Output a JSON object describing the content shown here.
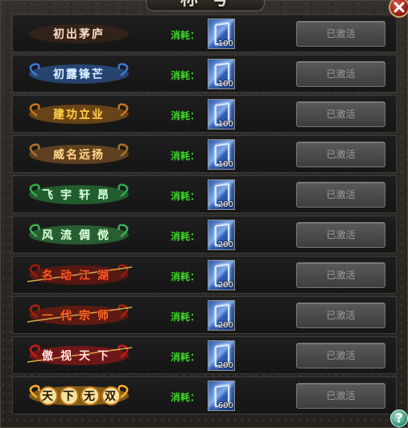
{
  "window": {
    "title": "称号",
    "help_label": "?"
  },
  "colors": {
    "cost_label": "#3fd82a",
    "button_text": "#9c9c9c"
  },
  "titles": [
    {
      "name": "初出茅庐",
      "cost_label": "消耗：",
      "item_icon": "scroll-icon",
      "item_count": "100",
      "button_label": "已激活",
      "badge_color": "#f0e0d0",
      "glow": "#7a3a1a"
    },
    {
      "name": "初露锋芒",
      "cost_label": "消耗：",
      "item_icon": "scroll-icon",
      "item_count": "100",
      "button_label": "已激活",
      "badge_color": "#dff0ff",
      "glow": "#3a7ad8"
    },
    {
      "name": "建功立业",
      "cost_label": "消耗：",
      "item_icon": "scroll-icon",
      "item_count": "100",
      "button_label": "已激活",
      "badge_color": "#ffd24a",
      "glow": "#c8761a"
    },
    {
      "name": "威名远扬",
      "cost_label": "消耗：",
      "item_icon": "scroll-icon",
      "item_count": "100",
      "button_label": "已激活",
      "badge_color": "#ffd890",
      "glow": "#b07028"
    },
    {
      "name": "飞宇轩昂",
      "cost_label": "消耗：",
      "item_icon": "scroll-icon",
      "item_count": "200",
      "button_label": "已激活",
      "badge_color": "#dfffe0",
      "glow": "#2fae4a"
    },
    {
      "name": "风流倜傥",
      "cost_label": "消耗：",
      "item_icon": "scroll-icon",
      "item_count": "200",
      "button_label": "已激活",
      "badge_color": "#e6ffe0",
      "glow": "#3cb050"
    },
    {
      "name": "名动江湖",
      "cost_label": "消耗：",
      "item_icon": "scroll-icon",
      "item_count": "200",
      "button_label": "已激活",
      "badge_color": "#ff5a2a",
      "glow": "#a01a0a"
    },
    {
      "name": "一代宗师",
      "cost_label": "消耗：",
      "item_icon": "scroll-icon",
      "item_count": "200",
      "button_label": "已激活",
      "badge_color": "#ff6a2a",
      "glow": "#b0200c"
    },
    {
      "name": "傲视天下",
      "cost_label": "消耗：",
      "item_icon": "scroll-icon",
      "item_count": "200",
      "button_label": "已激活",
      "badge_color": "#ffe6e0",
      "glow": "#d01818"
    },
    {
      "name": "天下无双",
      "cost_label": "消耗：",
      "item_icon": "scroll-icon",
      "item_count": "600",
      "button_label": "已激活",
      "badge_color": "#2a1400",
      "glow": "#ffb020"
    }
  ]
}
